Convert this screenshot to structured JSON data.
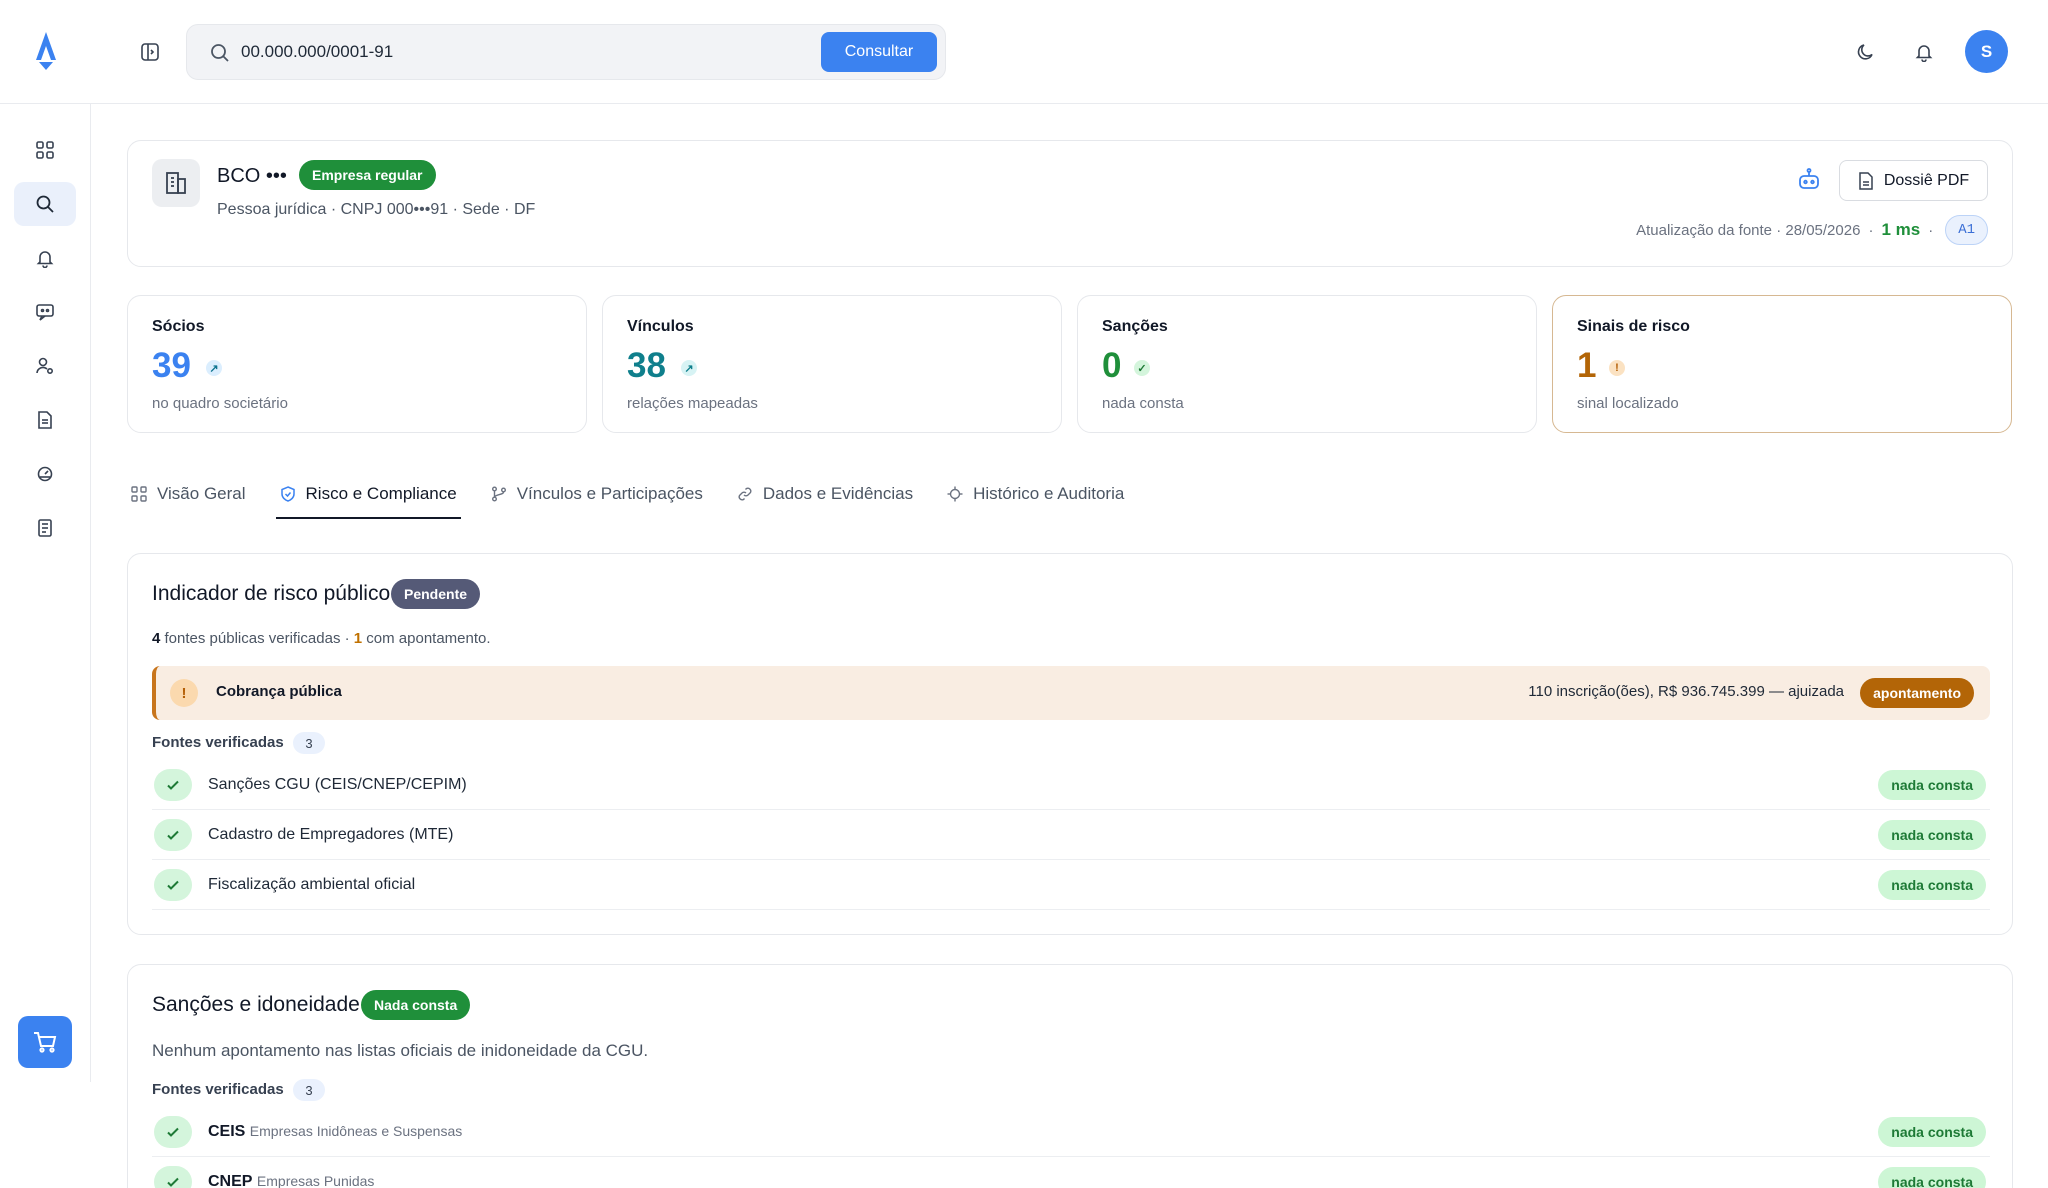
{
  "search": {
    "value": "00.000.000/0001-91",
    "button_label": "Consultar"
  },
  "user": {
    "avatar_initial": "S"
  },
  "company": {
    "name": "BCO •••",
    "status_badge": "Empresa regular",
    "subtitle": "Pessoa jurídica · CNPJ 000•••91 · Sede · DF",
    "pdf_button": "Dossiê PDF",
    "source_update": "Atualização da fonte · 28/05/2026",
    "separator": "·",
    "latency": "1 ms",
    "tier": "A1"
  },
  "stats": [
    {
      "label": "Sócios",
      "value": "39",
      "sub": "no quadro societário",
      "color": "#3b82f0"
    },
    {
      "label": "Vínculos",
      "value": "38",
      "sub": "relações mapeadas",
      "color": "#0f7f8c"
    },
    {
      "label": "Sanções",
      "value": "0",
      "sub": "nada consta",
      "color": "#1f8f3a"
    },
    {
      "label": "Sinais de risco",
      "value": "1",
      "sub": "sinal localizado",
      "color": "#b36507"
    }
  ],
  "tabs": [
    {
      "label": "Visão Geral"
    },
    {
      "label": "Risco e Compliance"
    },
    {
      "label": "Vínculos e Participações"
    },
    {
      "label": "Dados e Evidências"
    },
    {
      "label": "Histórico e Auditoria"
    }
  ],
  "risk_panel": {
    "title": "Indicador de risco público",
    "badge": "Pendente",
    "sources_count": "4",
    "sources_text": "fontes públicas verificadas ·",
    "findings_count": "1",
    "findings_text": "com apontamento.",
    "alert": {
      "icon": "!",
      "title": "Cobrança pública",
      "detail": "110 inscrição(ões), R$ 936.745.399 — ajuizada",
      "badge": "apontamento"
    },
    "verified_label": "Fontes verificadas",
    "verified_count": "3",
    "sources": [
      {
        "name": "Sanções CGU (CEIS/CNEP/CEPIM)",
        "status": "nada consta"
      },
      {
        "name": "Cadastro de Empregadores (MTE)",
        "status": "nada consta"
      },
      {
        "name": "Fiscalização ambiental oficial",
        "status": "nada consta"
      }
    ]
  },
  "sanctions_panel": {
    "title": "Sanções e idoneidade",
    "badge": "Nada consta",
    "description": "Nenhum apontamento nas listas oficiais de inidoneidade da CGU.",
    "verified_label": "Fontes verificadas",
    "verified_count": "3",
    "sources": [
      {
        "code": "CEIS",
        "name": "Empresas Inidôneas e Suspensas",
        "status": "nada consta"
      },
      {
        "code": "CNEP",
        "name": "Empresas Punidas",
        "status": "nada consta"
      }
    ]
  }
}
